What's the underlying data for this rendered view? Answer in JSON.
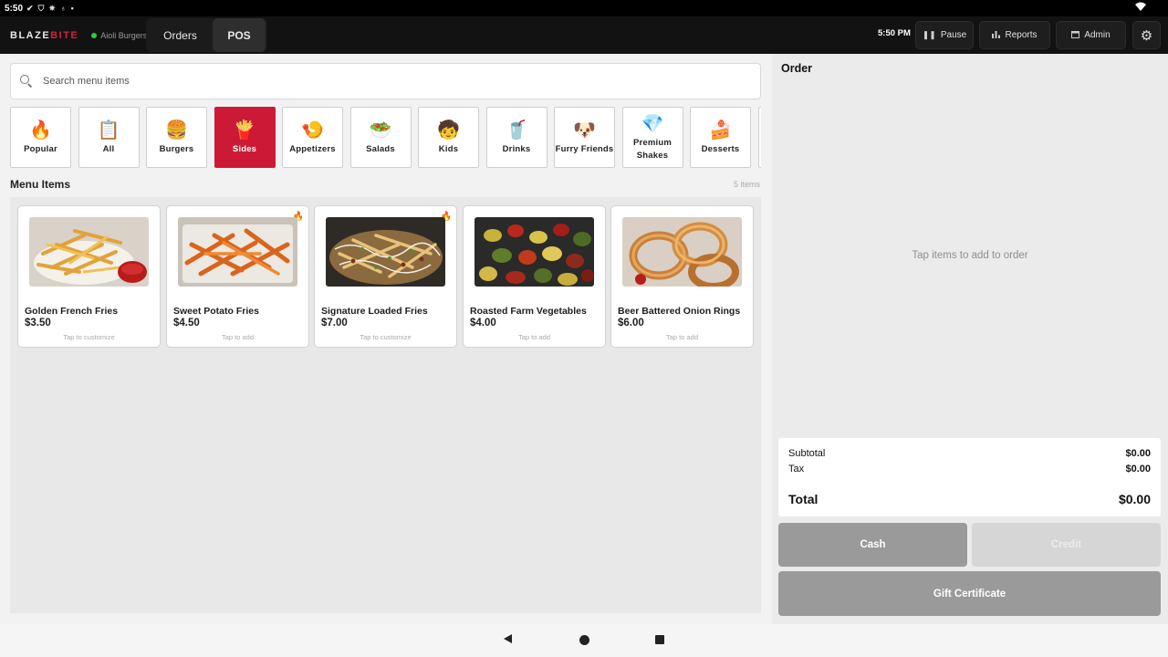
{
  "status_bar": {
    "time": "5:50",
    "icons": [
      "check-circle-icon",
      "shield-icon",
      "settings-cog-icon",
      "badge-icon",
      "dot-icon"
    ],
    "right_icons": [
      "wifi-icon"
    ]
  },
  "header": {
    "brand_left": "BLAZE",
    "brand_right": "BITE",
    "location": "Aioli Burgers",
    "tabs": [
      {
        "label": "Orders",
        "active": false
      },
      {
        "label": "POS",
        "active": true
      }
    ],
    "time": "5:50 PM",
    "buttons": {
      "pause": "Pause",
      "reports": "Reports",
      "admin": "Admin"
    },
    "colors": {
      "accent": "#cc1a36",
      "bar_bg": "#121212"
    }
  },
  "search": {
    "placeholder": "Search menu items",
    "value": ""
  },
  "categories": [
    {
      "label": "Popular",
      "icon": "🔥",
      "active": false
    },
    {
      "label": "All",
      "icon": "📋",
      "active": false
    },
    {
      "label": "Burgers",
      "icon": "🍔",
      "active": false
    },
    {
      "label": "Sides",
      "icon": "🍟",
      "active": true
    },
    {
      "label": "Appetizers",
      "icon": "🍤",
      "active": false
    },
    {
      "label": "Salads",
      "icon": "🥗",
      "active": false
    },
    {
      "label": "Kids",
      "icon": "🧒",
      "active": false
    },
    {
      "label": "Drinks",
      "icon": "🥤",
      "active": false
    },
    {
      "label": "Furry Friends",
      "icon": "🐶",
      "active": false
    },
    {
      "label": "Premium Shakes",
      "icon": "💎",
      "active": false
    },
    {
      "label": "Desserts",
      "icon": "🍰",
      "active": false
    }
  ],
  "menu": {
    "title": "Menu Items",
    "count": "5 items",
    "items": [
      {
        "name": "Golden French Fries",
        "price": "$3.50",
        "hint": "Tap to customize",
        "popular": false
      },
      {
        "name": "Sweet Potato Fries",
        "price": "$4.50",
        "hint": "Tap to add",
        "popular": true
      },
      {
        "name": "Signature Loaded Fries",
        "price": "$7.00",
        "hint": "Tap to customize",
        "popular": true
      },
      {
        "name": "Roasted Farm Vegetables",
        "price": "$4.00",
        "hint": "Tap to add",
        "popular": false
      },
      {
        "name": "Beer Battered Onion Rings",
        "price": "$6.00",
        "hint": "Tap to add",
        "popular": false
      }
    ]
  },
  "order": {
    "title": "Order",
    "empty_text": "Tap items to add to order",
    "subtotal_label": "Subtotal",
    "subtotal_value": "$0.00",
    "tax_label": "Tax",
    "tax_value": "$0.00",
    "total_label": "Total",
    "total_value": "$0.00",
    "cash_label": "Cash",
    "credit_label": "Credit",
    "gift_label": "Gift Certificate"
  }
}
